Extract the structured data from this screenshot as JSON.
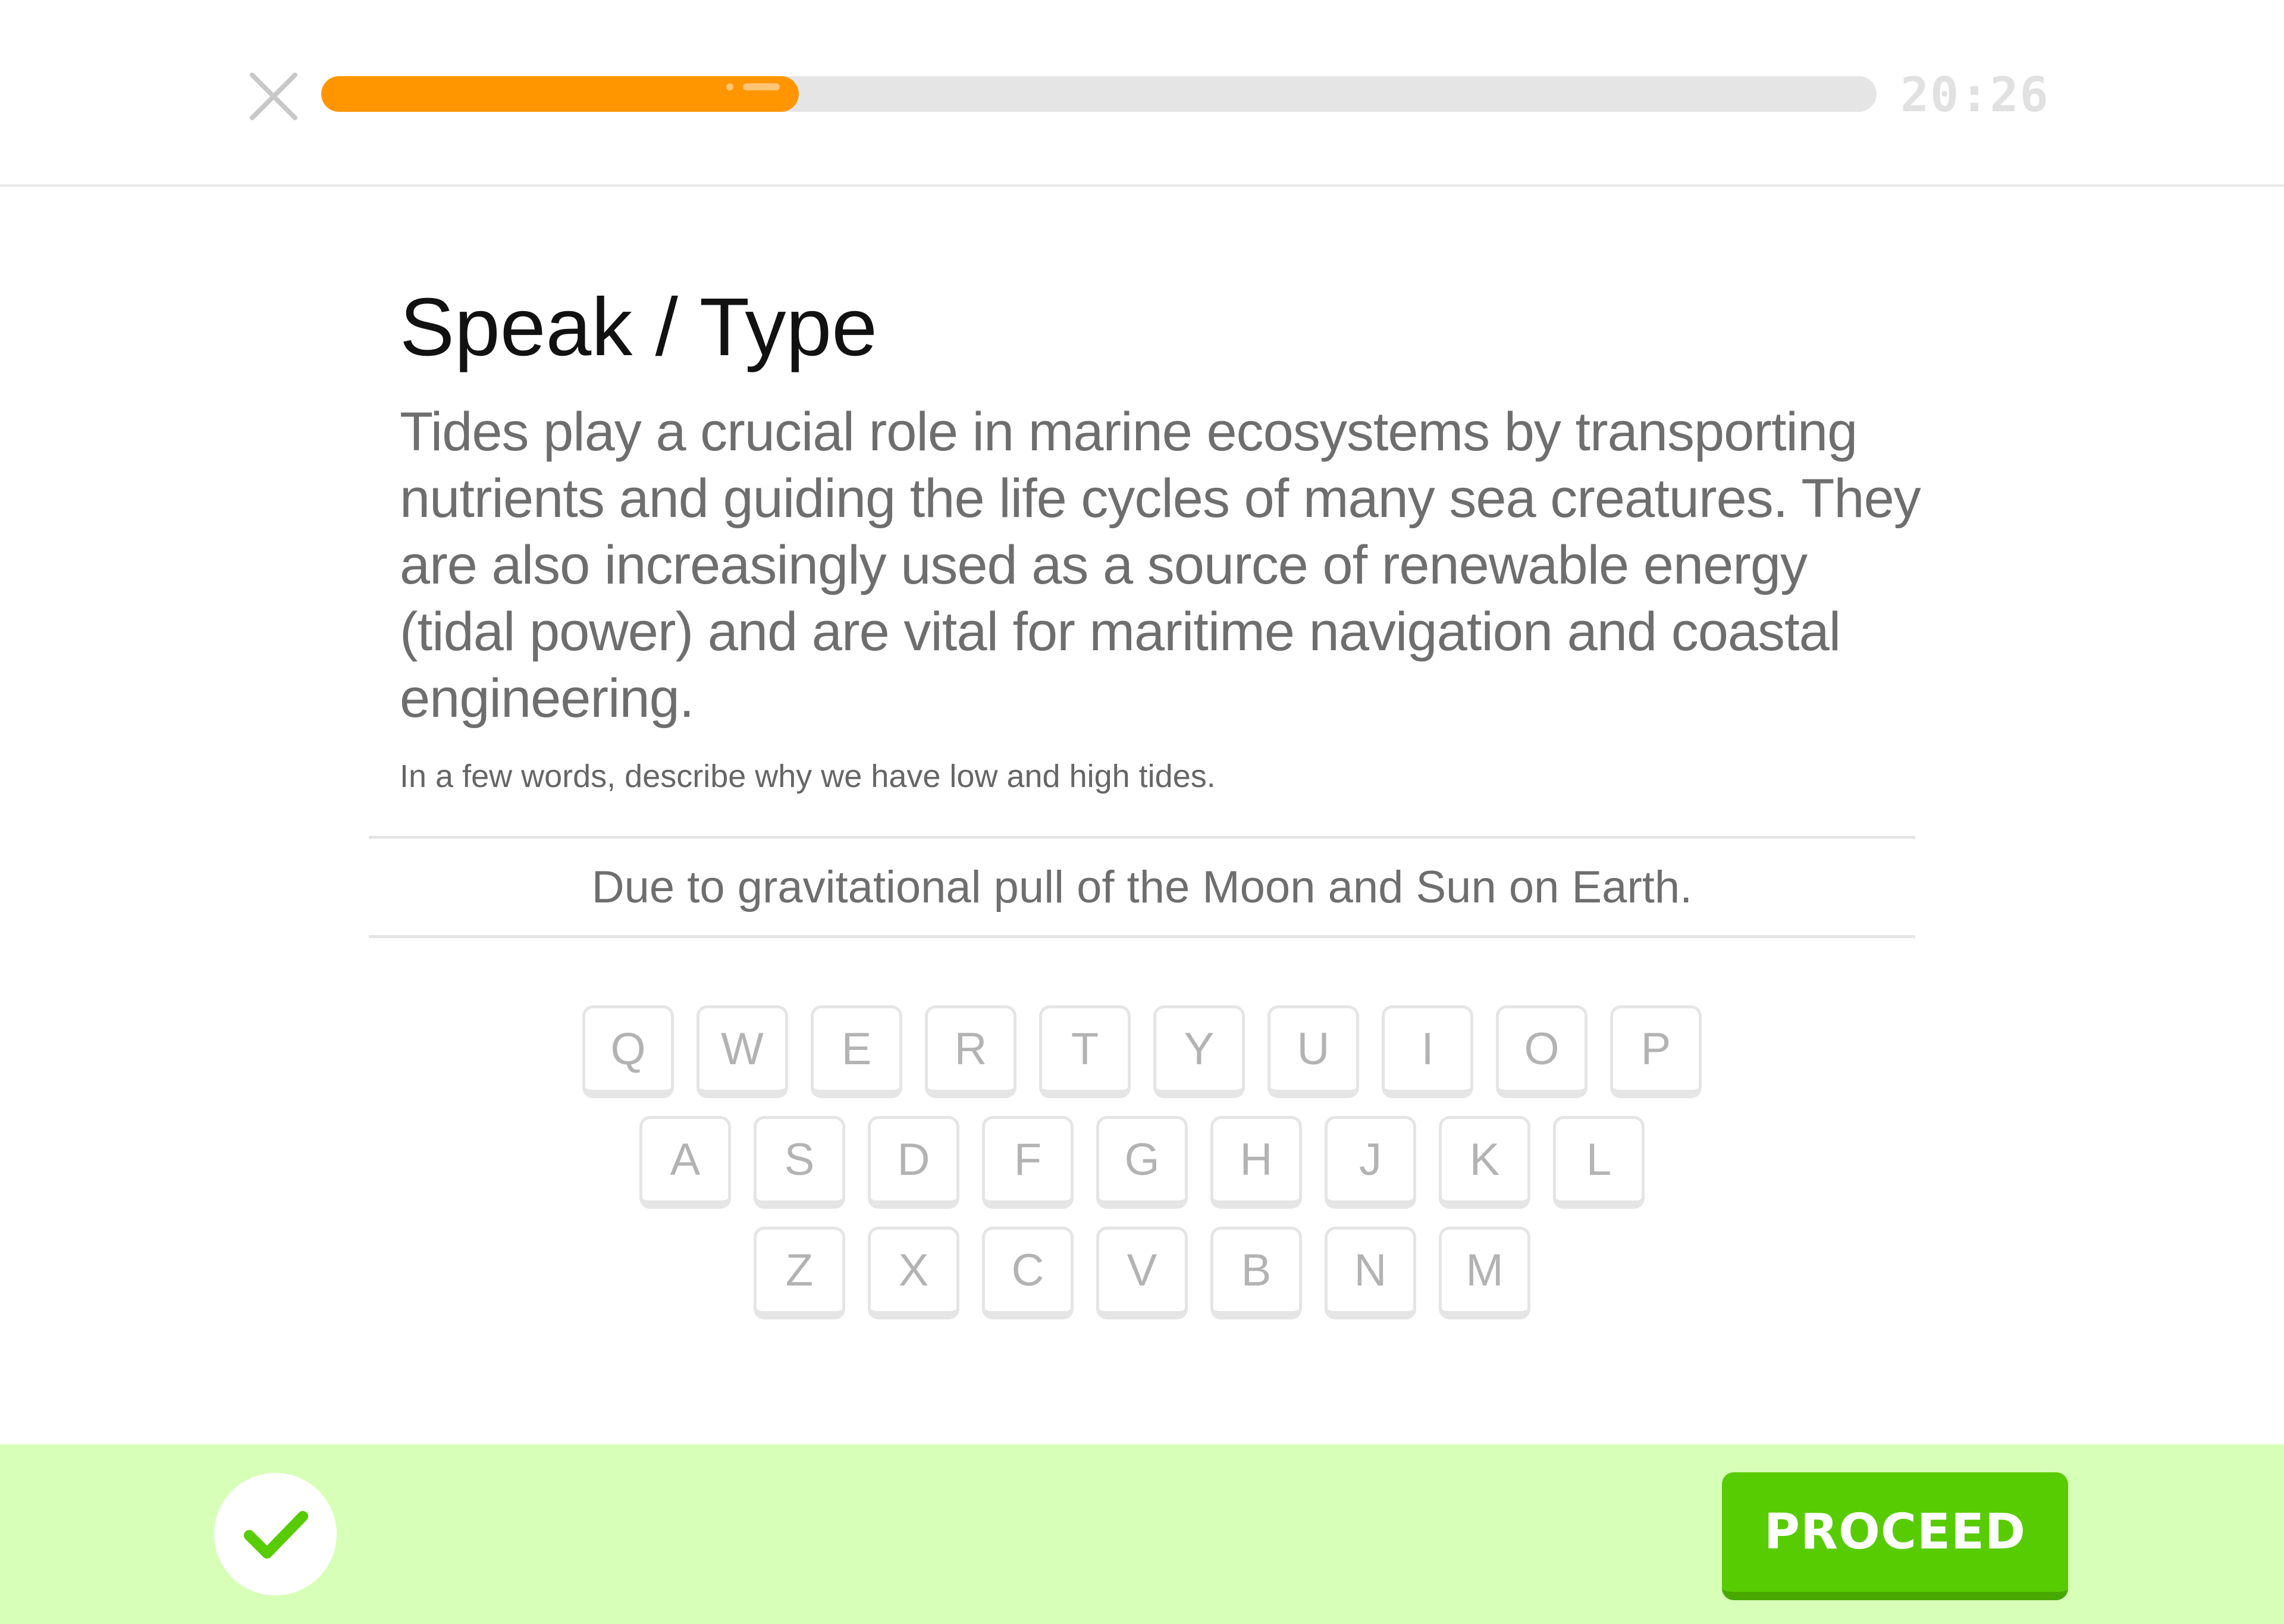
{
  "header": {
    "close_icon": "close-icon",
    "progress": 0.307,
    "progress_color": "#ff9600",
    "timer": "20:26"
  },
  "exercise": {
    "title": "Speak / Type",
    "passage": "Tides play a crucial role in marine ecosystems by transporting nutrients and guiding the life cycles of many sea creatures. They are also increasingly used as a source of renewable energy (tidal power) and are vital for maritime navigation and coastal engineering.",
    "prompt": "In a few words, describe why we have low and high tides.",
    "answer": "Due to gravitational pull of the Moon and Sun on Earth."
  },
  "keyboard": {
    "rows": [
      [
        "Q",
        "W",
        "E",
        "R",
        "T",
        "Y",
        "U",
        "I",
        "O",
        "P"
      ],
      [
        "A",
        "S",
        "D",
        "F",
        "G",
        "H",
        "J",
        "K",
        "L"
      ],
      [
        "Z",
        "X",
        "C",
        "V",
        "B",
        "N",
        "M"
      ]
    ]
  },
  "footer": {
    "status_icon": "checkmark-icon",
    "status_color": "#58cc02",
    "background_color": "#d7ffb8",
    "proceed_label": "PROCEED",
    "proceed_color": "#58cc02"
  }
}
